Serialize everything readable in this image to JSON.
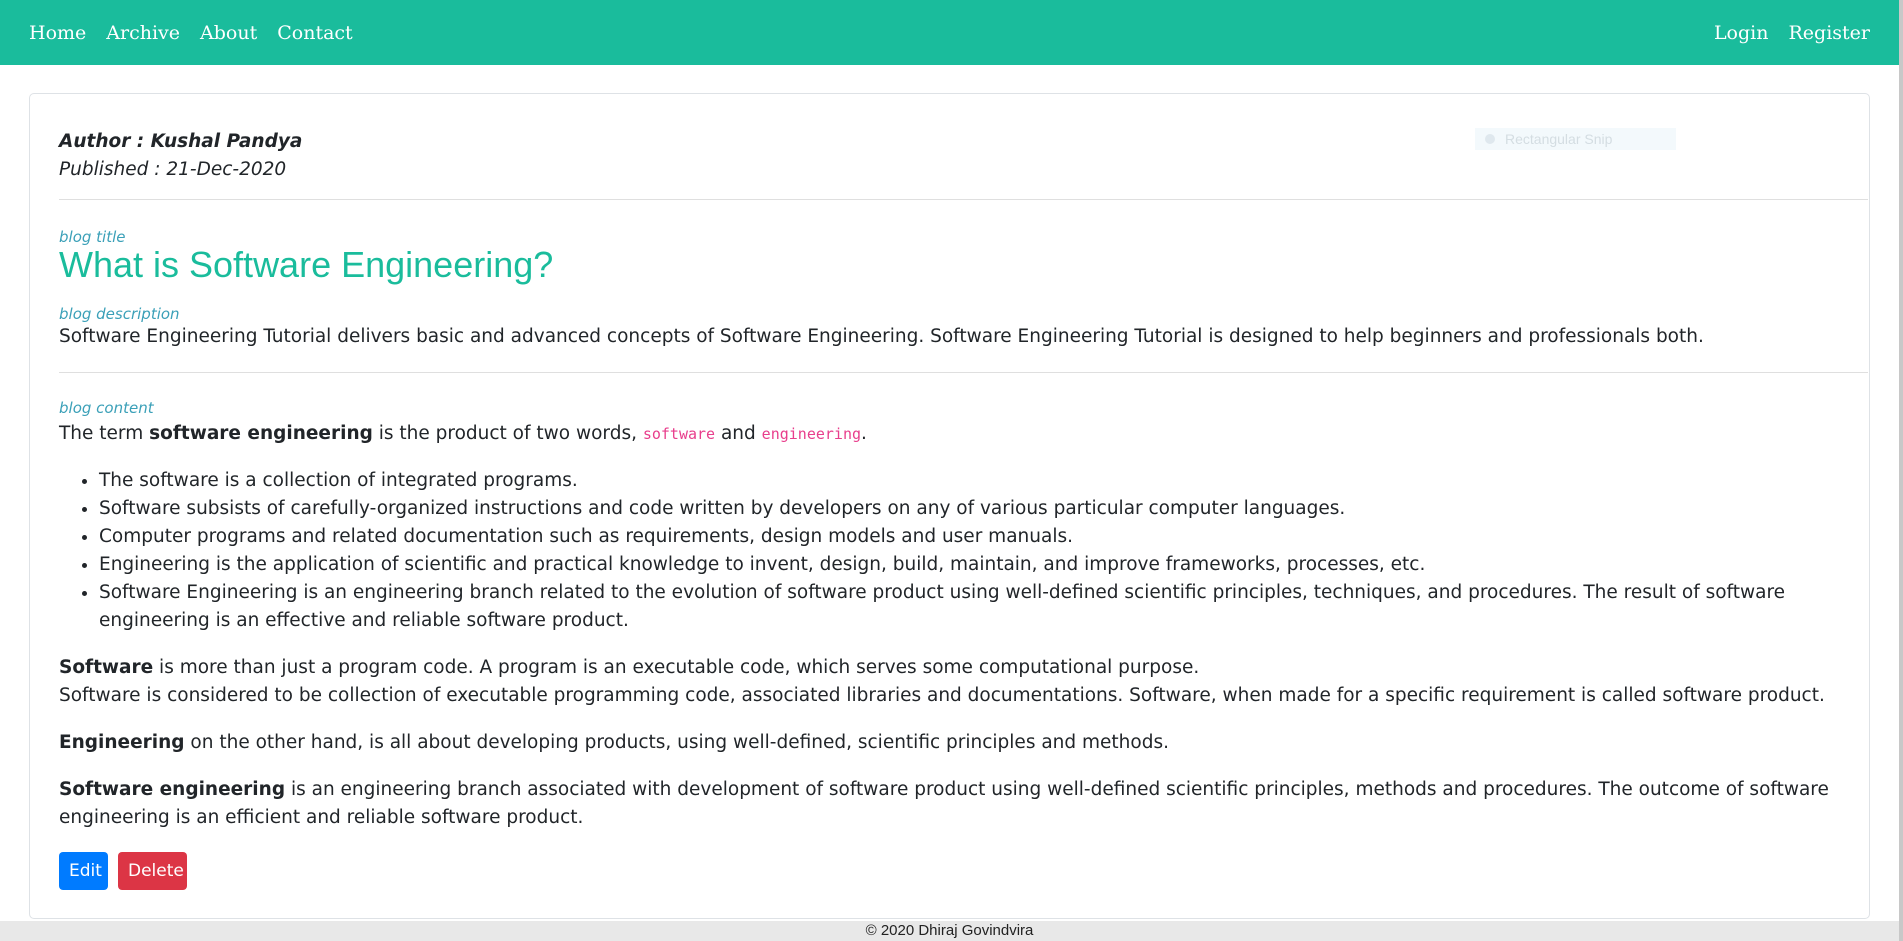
{
  "nav": {
    "left": [
      "Home",
      "Archive",
      "About",
      "Contact"
    ],
    "right": [
      "Login",
      "Register"
    ]
  },
  "meta": {
    "author": "Author : Kushal Pandya",
    "published": "Published : 21-Dec-2020"
  },
  "snip_overlay": "Rectangular Snip",
  "labels": {
    "title": "blog title",
    "description": "blog description",
    "content": "blog content"
  },
  "blog": {
    "title": "What is Software Engineering?",
    "description": "Software Engineering Tutorial delivers basic and advanced concepts of Software Engineering. Software Engineering Tutorial is designed to help beginners and professionals both.",
    "intro": {
      "pre": "The term ",
      "bold": "software engineering",
      "mid": " is the product of two words, ",
      "code1": "software",
      "and": " and ",
      "code2": "engineering",
      "end": "."
    },
    "bullets": [
      "The software is a collection of integrated programs.",
      "Software subsists of carefully-organized instructions and code written by developers on any of various particular computer languages.",
      "Computer programs and related documentation such as requirements, design models and user manuals.",
      "Engineering is the application of scientific and practical knowledge to invent, design, build, maintain, and improve frameworks, processes, etc.",
      "Software Engineering is an engineering branch related to the evolution of software product using well-defined scientific principles, techniques, and procedures. The result of software engineering is an effective and reliable software product."
    ],
    "p_software": {
      "bold": "Software",
      "line1": " is more than just a program code. A program is an executable code, which serves some computational purpose.",
      "line2": "Software is considered to be collection of executable programming code, associated libraries and documentations. Software, when made for a specific requirement is called software product."
    },
    "p_engineering": {
      "bold": "Engineering",
      "rest": " on the other hand, is all about developing products, using well-defined, scientific principles and methods."
    },
    "p_se": {
      "bold": "Software engineering",
      "rest": " is an engineering branch associated with development of software product using well-defined scientific principles, methods and procedures. The outcome of software engineering is an efficient and reliable software product."
    }
  },
  "buttons": {
    "edit": "Edit",
    "delete": "Delete"
  },
  "footer": "© 2020 Dhiraj Govindvira",
  "colors": {
    "accent": "#1abc9c",
    "edit": "#007bff",
    "delete": "#dc3545",
    "label": "#3ba0b8",
    "code": "#e83e8c"
  }
}
